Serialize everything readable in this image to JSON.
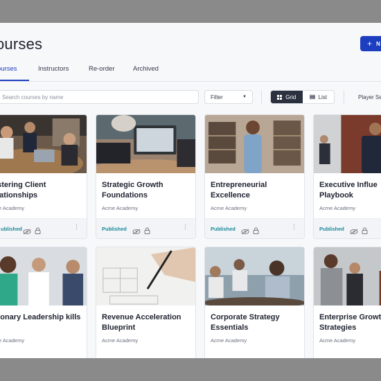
{
  "header": {
    "title": "ourses",
    "new_button": "N"
  },
  "tabs": [
    "ourses",
    "Instructors",
    "Re-order",
    "Archived"
  ],
  "toolbar": {
    "search_placeholder": "Search courses by name",
    "filter_label": "Filter",
    "grid_label": "Grid",
    "list_label": "List",
    "player_label": "Player Se"
  },
  "cards": [
    {
      "title": "astering Client elationships",
      "org": "cme Academy",
      "status": "ublished"
    },
    {
      "title": "Strategic Growth Foundations",
      "org": "Acme Academy",
      "status": "Published"
    },
    {
      "title": "Entrepreneurial Excellence",
      "org": "Acme Academy",
      "status": "Published"
    },
    {
      "title": "Executive Influe Playbook",
      "org": "Acme Academy",
      "status": "Published"
    },
    {
      "title": "isionary Leadership kills",
      "org": "cme Academy",
      "status": ""
    },
    {
      "title": "Revenue Acceleration Blueprint",
      "org": "Acme Academy",
      "status": ""
    },
    {
      "title": "Corporate Strategy Essentials",
      "org": "Acme Academy",
      "status": ""
    },
    {
      "title": "Enterprise Growt Strategies",
      "org": "Acme Academy",
      "status": ""
    }
  ],
  "colors": {
    "accent": "#1d3fbf",
    "published": "#1a8a99",
    "toggle_active": "#2c3140"
  }
}
